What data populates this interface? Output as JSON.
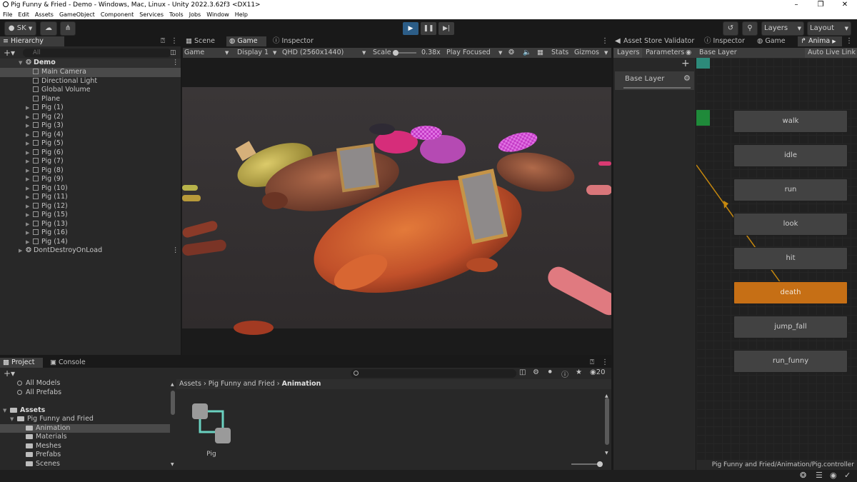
{
  "window": {
    "title": "Pig Funny & Fried - Demo - Windows, Mac, Linux - Unity 2022.3.62f3 <DX11>"
  },
  "menu": [
    "File",
    "Edit",
    "Assets",
    "GameObject",
    "Component",
    "Services",
    "Tools",
    "Jobs",
    "Window",
    "Help"
  ],
  "toolbar": {
    "account": "SK",
    "layers": "Layers",
    "layout": "Layout"
  },
  "hierarchy": {
    "tab": "Hierarchy",
    "search_placeholder": "All",
    "scene": "Demo",
    "items": [
      "Main Camera",
      "Directional Light",
      "Global Volume",
      "Plane",
      "Pig (1)",
      "Pig (2)",
      "Pig (3)",
      "Pig (4)",
      "Pig (5)",
      "Pig (6)",
      "Pig (7)",
      "Pig (8)",
      "Pig (9)",
      "Pig (10)",
      "Pig (11)",
      "Pig (12)",
      "Pig (15)",
      "Pig (13)",
      "Pig (16)",
      "Pig (14)"
    ],
    "dontdestroy": "DontDestroyOnLoad"
  },
  "center_tabs": {
    "scene": "Scene",
    "game": "Game",
    "inspector": "Inspector"
  },
  "game_bar": {
    "mode": "Game",
    "display": "Display 1",
    "resolution": "QHD (2560x1440)",
    "scale_label": "Scale",
    "scale_value": "0.38x",
    "play_focused": "Play Focused",
    "stats": "Stats",
    "gizmos": "Gizmos"
  },
  "right_tabs": {
    "asset_store": "Asset Store Validator",
    "inspector": "Inspector",
    "game": "Game",
    "animator": "Anima"
  },
  "animator": {
    "layers_tab": "Layers",
    "parameters_tab": "Parameters",
    "breadcrumb": "Base Layer",
    "live_link": "Auto Live Link",
    "layer_name": "Base Layer",
    "states": [
      "walk",
      "idle",
      "run",
      "look",
      "hit",
      "death",
      "jump_fall",
      "run_funny"
    ],
    "status_path": "Pig Funny and Fried/Animation/Pig.controller"
  },
  "project": {
    "tab_project": "Project",
    "tab_console": "Console",
    "favorites": [
      "All Models",
      "All Prefabs"
    ],
    "assets_root": "Assets",
    "pack_folder": "Pig Funny and Fried",
    "subfolders": [
      "Animation",
      "Materials",
      "Meshes",
      "Prefabs",
      "Scenes"
    ],
    "breadcrumb": [
      "Assets",
      "Pig Funny and Fried",
      "Animation"
    ],
    "asset_name": "Pig",
    "count": "20"
  }
}
